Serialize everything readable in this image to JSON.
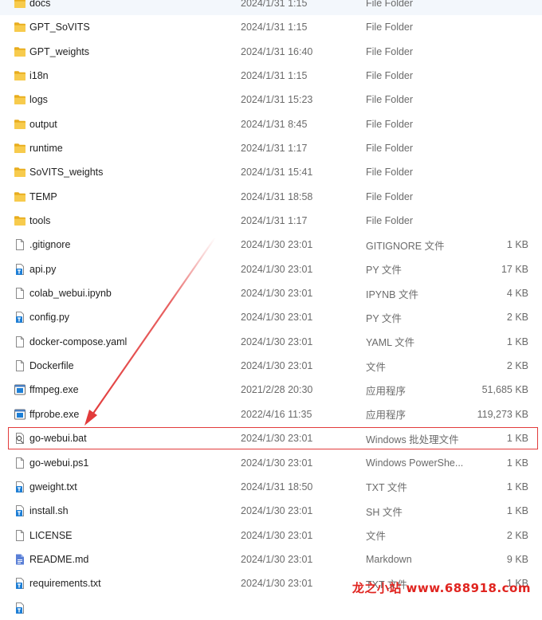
{
  "files": [
    {
      "name": "docs",
      "date": "2024/1/31 1:15",
      "type": "File Folder",
      "size": "",
      "icon": "folder-icon"
    },
    {
      "name": "GPT_SoVITS",
      "date": "2024/1/31 1:15",
      "type": "File Folder",
      "size": "",
      "icon": "folder-icon"
    },
    {
      "name": "GPT_weights",
      "date": "2024/1/31 16:40",
      "type": "File Folder",
      "size": "",
      "icon": "folder-icon"
    },
    {
      "name": "i18n",
      "date": "2024/1/31 1:15",
      "type": "File Folder",
      "size": "",
      "icon": "folder-icon"
    },
    {
      "name": "logs",
      "date": "2024/1/31 15:23",
      "type": "File Folder",
      "size": "",
      "icon": "folder-icon"
    },
    {
      "name": "output",
      "date": "2024/1/31 8:45",
      "type": "File Folder",
      "size": "",
      "icon": "folder-icon"
    },
    {
      "name": "runtime",
      "date": "2024/1/31 1:17",
      "type": "File Folder",
      "size": "",
      "icon": "folder-icon"
    },
    {
      "name": "SoVITS_weights",
      "date": "2024/1/31 15:41",
      "type": "File Folder",
      "size": "",
      "icon": "folder-icon"
    },
    {
      "name": "TEMP",
      "date": "2024/1/31 18:58",
      "type": "File Folder",
      "size": "",
      "icon": "folder-icon"
    },
    {
      "name": "tools",
      "date": "2024/1/31 1:17",
      "type": "File Folder",
      "size": "",
      "icon": "folder-icon"
    },
    {
      "name": ".gitignore",
      "date": "2024/1/30 23:01",
      "type": "GITIGNORE 文件",
      "size": "1 KB",
      "icon": "blank-file-icon"
    },
    {
      "name": "api.py",
      "date": "2024/1/30 23:01",
      "type": "PY 文件",
      "size": "17 KB",
      "icon": "text-file-icon"
    },
    {
      "name": "colab_webui.ipynb",
      "date": "2024/1/30 23:01",
      "type": "IPYNB 文件",
      "size": "4 KB",
      "icon": "blank-file-icon"
    },
    {
      "name": "config.py",
      "date": "2024/1/30 23:01",
      "type": "PY 文件",
      "size": "2 KB",
      "icon": "text-file-icon"
    },
    {
      "name": "docker-compose.yaml",
      "date": "2024/1/30 23:01",
      "type": "YAML 文件",
      "size": "1 KB",
      "icon": "blank-file-icon"
    },
    {
      "name": "Dockerfile",
      "date": "2024/1/30 23:01",
      "type": "文件",
      "size": "2 KB",
      "icon": "blank-file-icon"
    },
    {
      "name": "ffmpeg.exe",
      "date": "2021/2/28 20:30",
      "type": "应用程序",
      "size": "51,685 KB",
      "icon": "exe-file-icon"
    },
    {
      "name": "ffprobe.exe",
      "date": "2022/4/16 11:35",
      "type": "应用程序",
      "size": "119,273 KB",
      "icon": "exe-file-icon"
    },
    {
      "name": "go-webui.bat",
      "date": "2024/1/30 23:01",
      "type": "Windows 批处理文件",
      "size": "1 KB",
      "icon": "batch-file-icon"
    },
    {
      "name": "go-webui.ps1",
      "date": "2024/1/30 23:01",
      "type": "Windows PowerShe...",
      "size": "1 KB",
      "icon": "blank-file-icon"
    },
    {
      "name": "gweight.txt",
      "date": "2024/1/31 18:50",
      "type": "TXT 文件",
      "size": "1 KB",
      "icon": "text-file-icon"
    },
    {
      "name": "install.sh",
      "date": "2024/1/30 23:01",
      "type": "SH 文件",
      "size": "1 KB",
      "icon": "text-file-icon"
    },
    {
      "name": "LICENSE",
      "date": "2024/1/30 23:01",
      "type": "文件",
      "size": "2 KB",
      "icon": "blank-file-icon"
    },
    {
      "name": "README.md",
      "date": "2024/1/30 23:01",
      "type": "Markdown",
      "size": "9 KB",
      "icon": "markdown-file-icon"
    },
    {
      "name": "requirements.txt",
      "date": "2024/1/30 23:01",
      "type": "TXT 文件",
      "size": "1 KB",
      "icon": "text-file-icon"
    },
    {
      "name": "",
      "date": "",
      "type": "",
      "size": "",
      "icon": "text-file-icon"
    }
  ],
  "highlighted_file": "go-webui.bat",
  "annotation_color": "#e23b3b",
  "folder_color": "#f4c441",
  "file_accent_color": "#1e7fd6",
  "watermark": "龙之小站 www.688918.com"
}
